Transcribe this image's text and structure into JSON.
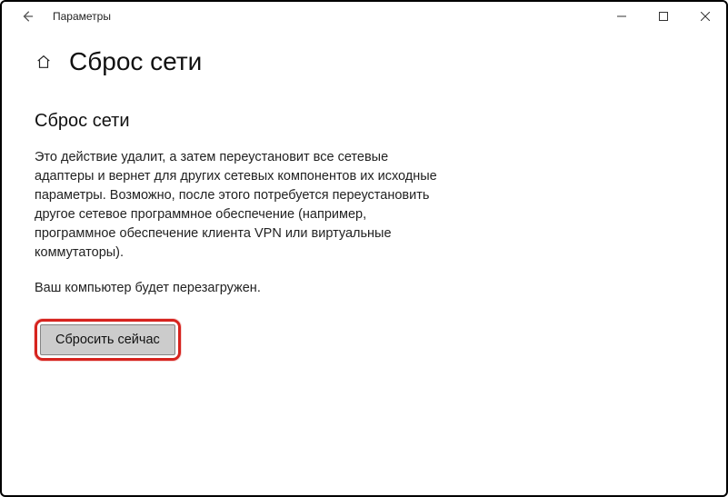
{
  "window": {
    "app_title": "Параметры"
  },
  "header": {
    "page_title": "Сброс сети"
  },
  "main": {
    "section_heading": "Сброс сети",
    "description": "Это действие удалит, а затем переустановит все сетевые адаптеры и вернет для других сетевых компонентов их исходные параметры. Возможно, после этого потребуется переустановить другое сетевое программное обеспечение (например, программное обеспечение клиента VPN или виртуальные коммутаторы).",
    "notice": "Ваш компьютер будет перезагружен.",
    "reset_button_label": "Сбросить сейчас"
  }
}
